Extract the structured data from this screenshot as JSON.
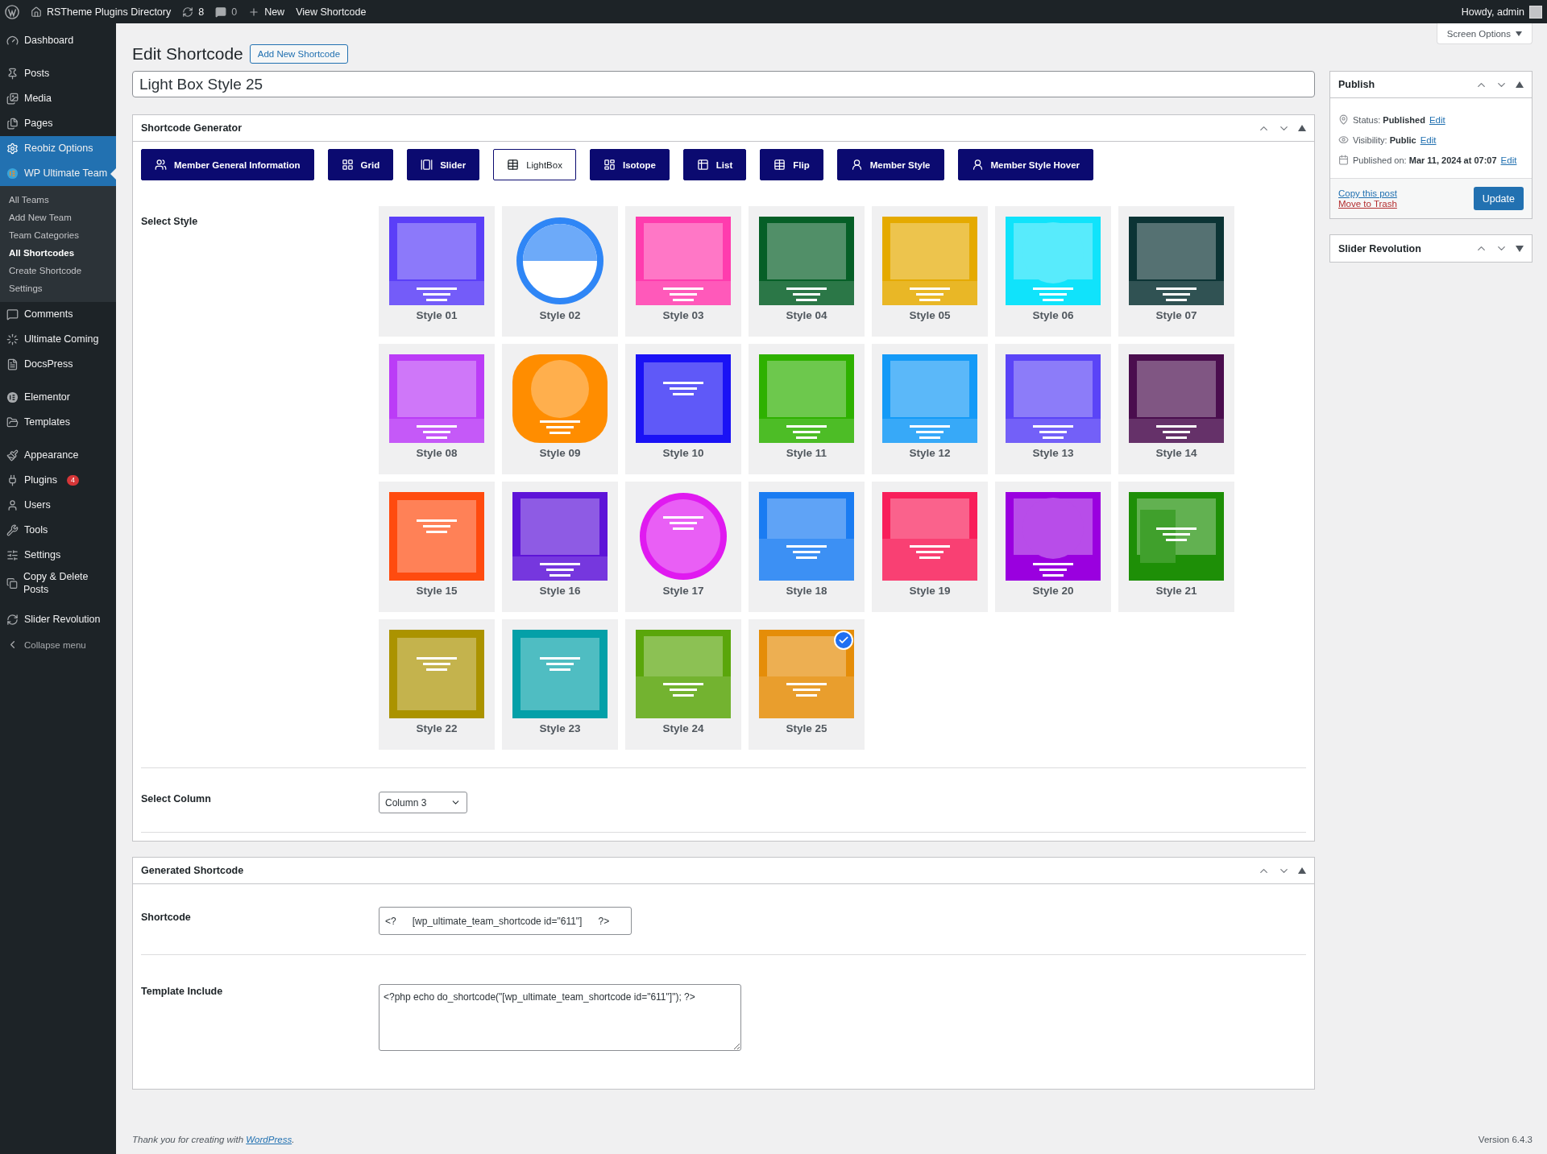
{
  "admin_bar": {
    "site": "RSTheme Plugins Directory",
    "updates": "8",
    "comments": "0",
    "new": "New",
    "view": "View Shortcode",
    "greeting": "Howdy, admin"
  },
  "sidebar": {
    "groups": [
      [
        {
          "label": "Dashboard",
          "selected": false
        }
      ],
      [
        {
          "label": "Posts",
          "selected": false
        },
        {
          "label": "Media",
          "selected": false
        },
        {
          "label": "Pages",
          "selected": false
        },
        {
          "label": "Reobiz Options",
          "selected": true
        },
        {
          "label": "WP Ultimate Team",
          "selected": true,
          "children": [
            {
              "label": "All Teams",
              "selected": false
            },
            {
              "label": "Add New Team",
              "selected": false
            },
            {
              "label": "Team Categories",
              "selected": false
            },
            {
              "label": "All Shortcodes",
              "selected": true
            },
            {
              "label": "Create Shortcode",
              "selected": false
            },
            {
              "label": "Settings",
              "selected": false
            }
          ]
        },
        {
          "label": "Comments",
          "selected": false
        },
        {
          "label": "Ultimate Coming",
          "selected": false
        },
        {
          "label": "DocsPress",
          "selected": false
        }
      ],
      [
        {
          "label": "Elementor",
          "selected": false
        },
        {
          "label": "Templates",
          "selected": false
        }
      ],
      [
        {
          "label": "Appearance",
          "selected": false
        },
        {
          "label": "Plugins",
          "selected": false,
          "badge": "4"
        },
        {
          "label": "Users",
          "selected": false
        },
        {
          "label": "Tools",
          "selected": false
        },
        {
          "label": "Settings",
          "selected": false
        },
        {
          "label": "Copy & Delete Posts",
          "selected": false
        }
      ],
      [
        {
          "label": "Slider Revolution",
          "selected": false
        },
        {
          "label": "Collapse menu",
          "selected": false
        }
      ]
    ]
  },
  "screen_options": "Screen Options",
  "heading": "Edit Shortcode",
  "add_new": "Add New Shortcode",
  "title_value": "Light Box Style 25",
  "generator": {
    "title": "Shortcode Generator",
    "expanded": true,
    "tabs": [
      {
        "label": "Member General Information",
        "selected": false
      },
      {
        "label": "Grid",
        "selected": false
      },
      {
        "label": "Slider",
        "selected": false
      },
      {
        "label": "LightBox",
        "selected": true
      },
      {
        "label": "Isotope",
        "selected": false
      },
      {
        "label": "List",
        "selected": false
      },
      {
        "label": "Flip",
        "selected": false
      },
      {
        "label": "Member Style",
        "selected": false
      },
      {
        "label": "Member Style Hover",
        "selected": false
      }
    ],
    "style_label": "Select Style",
    "styles": [
      {
        "label": "Style 01",
        "color": "#5b3ff8",
        "selected": false
      },
      {
        "label": "Style 02",
        "color": "#2f86f6",
        "selected": false
      },
      {
        "label": "Style 03",
        "color": "#ff3cae",
        "selected": false
      },
      {
        "label": "Style 04",
        "color": "#065f27",
        "selected": false
      },
      {
        "label": "Style 05",
        "color": "#e5aa00",
        "selected": false
      },
      {
        "label": "Style 06",
        "color": "#10e3fb",
        "selected": false
      },
      {
        "label": "Style 07",
        "color": "#0c3435",
        "selected": false
      },
      {
        "label": "Style 08",
        "color": "#bb3cf7",
        "selected": false
      },
      {
        "label": "Style 09",
        "color": "#ff8d00",
        "selected": false
      },
      {
        "label": "Style 10",
        "color": "#1a12f5",
        "selected": false
      },
      {
        "label": "Style 11",
        "color": "#2eb100",
        "selected": false
      },
      {
        "label": "Style 12",
        "color": "#149af7",
        "selected": false
      },
      {
        "label": "Style 13",
        "color": "#5a44f7",
        "selected": false
      },
      {
        "label": "Style 14",
        "color": "#4a0d4e",
        "selected": false
      },
      {
        "label": "Style 15",
        "color": "#ff4b0f",
        "selected": false
      },
      {
        "label": "Style 16",
        "color": "#5e14d8",
        "selected": false
      },
      {
        "label": "Style 17",
        "color": "#e01af0",
        "selected": false
      },
      {
        "label": "Style 18",
        "color": "#1a7cf2",
        "selected": false
      },
      {
        "label": "Style 19",
        "color": "#f81e5a",
        "selected": false
      },
      {
        "label": "Style 20",
        "color": "#9a00df",
        "selected": false
      },
      {
        "label": "Style 21",
        "color": "#1e8f07",
        "selected": false
      },
      {
        "label": "Style 22",
        "color": "#ab9300",
        "selected": false
      },
      {
        "label": "Style 23",
        "color": "#04a0a8",
        "selected": false
      },
      {
        "label": "Style 24",
        "color": "#5aa60b",
        "selected": false
      },
      {
        "label": "Style 25",
        "color": "#e58d08",
        "selected": true
      }
    ],
    "column_label": "Select Column",
    "column_value": "Column 3"
  },
  "generated": {
    "title": "Generated Shortcode",
    "expanded": true,
    "shortcode_label": "Shortcode",
    "open_tag": "<?",
    "shortcode": "[wp_ultimate_team_shortcode id=\"611\"]",
    "close_tag": "?>",
    "template_label": "Template Include",
    "template": "<?php echo do_shortcode(\"[wp_ultimate_team_shortcode id=\"611\"]\"); ?>"
  },
  "publish": {
    "title": "Publish",
    "expanded": true,
    "rows": [
      {
        "label": "Status:",
        "value": "Published",
        "link": "Edit"
      },
      {
        "label": "Visibility:",
        "value": "Public",
        "link": "Edit"
      },
      {
        "label": "Published on:",
        "value": "Mar 11, 2024 at 07:07",
        "link": "Edit"
      }
    ],
    "copy": "Copy this post",
    "trash": "Move to Trash",
    "update": "Update"
  },
  "slider_box": {
    "title": "Slider Revolution",
    "expanded": false
  },
  "footer": {
    "text": "Thank you for creating with ",
    "link": "WordPress",
    "after": ".",
    "version": "Version 6.4.3"
  }
}
